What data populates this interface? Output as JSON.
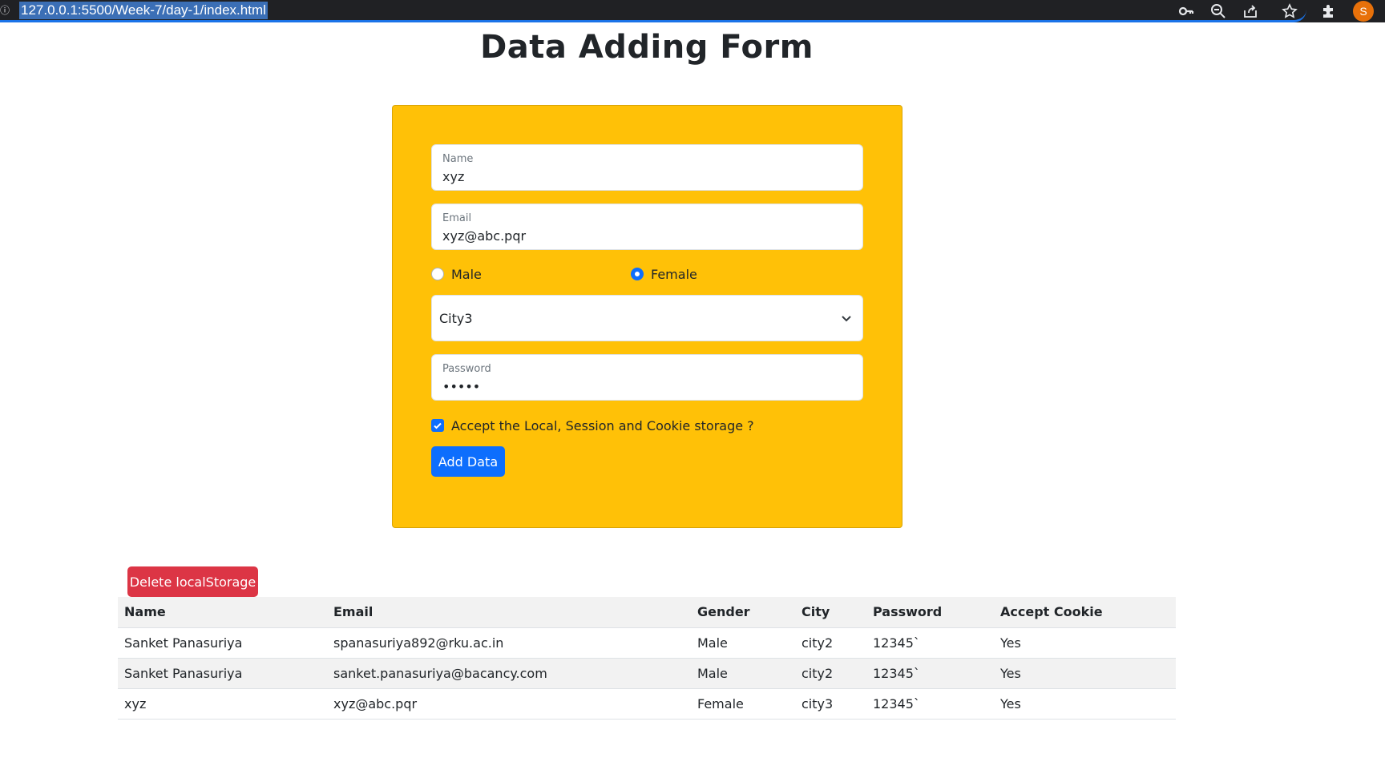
{
  "browser": {
    "url": "127.0.0.1:5500/Week-7/day-1/index.html",
    "site_info_glyph": "ⓘ",
    "profile_initial": "S",
    "icons": [
      "key-icon",
      "zoom-icon",
      "share-icon",
      "star-icon",
      "extensions-icon"
    ]
  },
  "page": {
    "title": "Data Adding Form"
  },
  "form": {
    "name": {
      "label": "Name",
      "value": "xyz"
    },
    "email": {
      "label": "Email",
      "value": "xyz@abc.pqr"
    },
    "gender": {
      "options": [
        {
          "label": "Male",
          "checked": false
        },
        {
          "label": "Female",
          "checked": true
        }
      ]
    },
    "city": {
      "selected": "City3"
    },
    "password": {
      "label": "Password",
      "value": "•••••"
    },
    "accept": {
      "label": "Accept the Local, Session and Cookie storage ?",
      "checked": true
    },
    "submit_label": "Add Data",
    "background_color": "#ffc107"
  },
  "delete_button": {
    "label": "Delete localStorage",
    "color": "#dc3545"
  },
  "table": {
    "headers": [
      "Name",
      "Email",
      "Gender",
      "City",
      "Password",
      "Accept Cookie"
    ],
    "rows": [
      [
        "Sanket Panasuriya",
        "spanasuriya892@rku.ac.in",
        "Male",
        "city2",
        "12345`",
        "Yes"
      ],
      [
        "Sanket Panasuriya",
        "sanket.panasuriya@bacancy.com",
        "Male",
        "city2",
        "12345`",
        "Yes"
      ],
      [
        "xyz",
        "xyz@abc.pqr",
        "Female",
        "city3",
        "12345`",
        "Yes"
      ]
    ]
  },
  "colors": {
    "primary": "#0d6efd",
    "danger": "#dc3545",
    "warning": "#ffc107"
  }
}
